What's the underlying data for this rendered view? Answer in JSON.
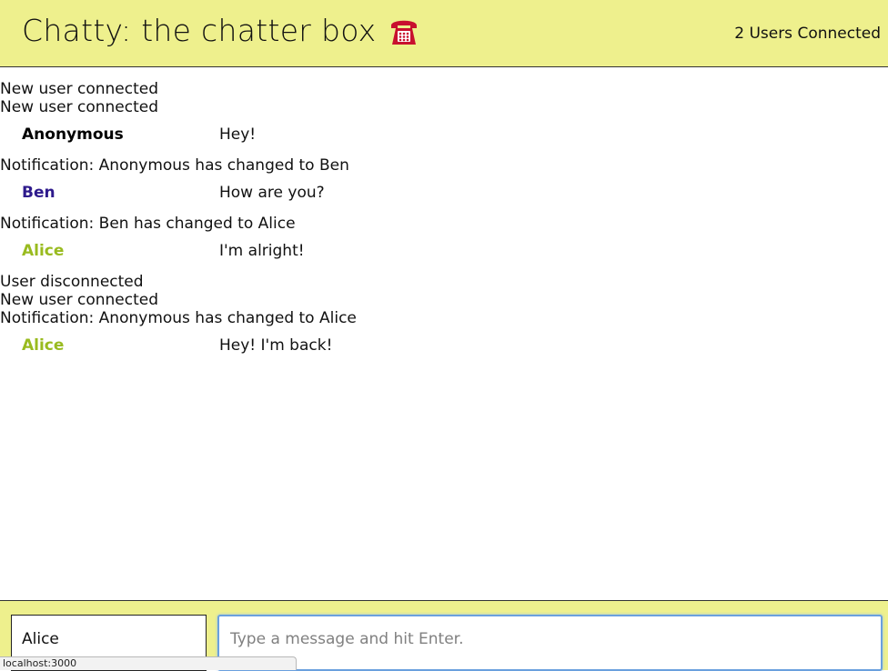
{
  "navbar": {
    "title": "Chatty: the chatter box",
    "icon": "telephone-icon",
    "user_count": "2 Users Connected",
    "background": "#eef08d"
  },
  "messages": [
    {
      "type": "notice",
      "text": "New user connected"
    },
    {
      "type": "notice",
      "text": "New user connected"
    },
    {
      "type": "message",
      "username": "Anonymous",
      "content": "Hey!",
      "color": "#000000"
    },
    {
      "type": "notice",
      "text": "Notification: Anonymous has changed to Ben"
    },
    {
      "type": "message",
      "username": "Ben",
      "content": "How are you?",
      "color": "#2e1a8c"
    },
    {
      "type": "notice",
      "text": "Notification: Ben has changed to Alice"
    },
    {
      "type": "message",
      "username": "Alice",
      "content": "I'm alright!",
      "color": "#99bb1f"
    },
    {
      "type": "notice",
      "text": "User disconnected"
    },
    {
      "type": "notice",
      "text": "New user connected"
    },
    {
      "type": "notice",
      "text": "Notification: Anonymous has changed to Alice"
    },
    {
      "type": "message",
      "username": "Alice",
      "content": "Hey! I'm back!",
      "color": "#99bb1f"
    }
  ],
  "footer": {
    "username_value": "Alice",
    "message_placeholder": "Type a message and hit Enter."
  },
  "status_bar": {
    "url": "localhost:3000"
  }
}
